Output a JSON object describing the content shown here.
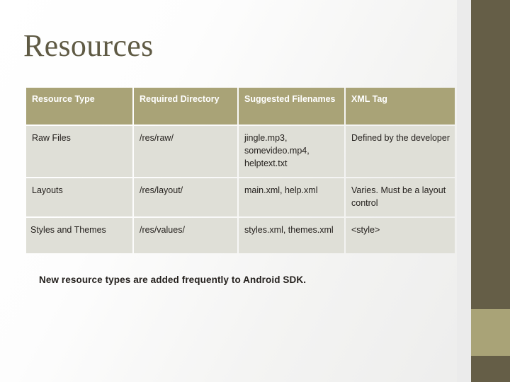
{
  "slide": {
    "title": "Resources",
    "caption": "New resource types are added frequently to Android SDK.",
    "colors": {
      "title_text": "#5F5A44",
      "header_bg": "#A9A377",
      "header_text": "#FFFFFF",
      "body_bg": "#DFDFD7",
      "body_text": "#231F1C",
      "rail_dark": "#655E47",
      "rail_accent": "#A9A377",
      "slide_bg": "#FFFFFF"
    }
  },
  "table": {
    "headers": [
      "Resource Type",
      "Required Directory",
      "Suggested Filenames",
      "XML Tag"
    ],
    "rows": [
      {
        "resource_type": "Raw Files",
        "required_directory": "/res/raw/",
        "suggested_filenames": "jingle.mp3, somevideo.mp4, helptext.txt",
        "xml_tag": "Defined by the developer"
      },
      {
        "resource_type": "Layouts",
        "required_directory": "/res/layout/",
        "suggested_filenames": "main.xml, help.xml",
        "xml_tag": "Varies.  Must be a layout control"
      },
      {
        "resource_type": "Styles and Themes",
        "required_directory": "/res/values/",
        "suggested_filenames": "styles.xml, themes.xml",
        "xml_tag": "<style>"
      }
    ]
  }
}
